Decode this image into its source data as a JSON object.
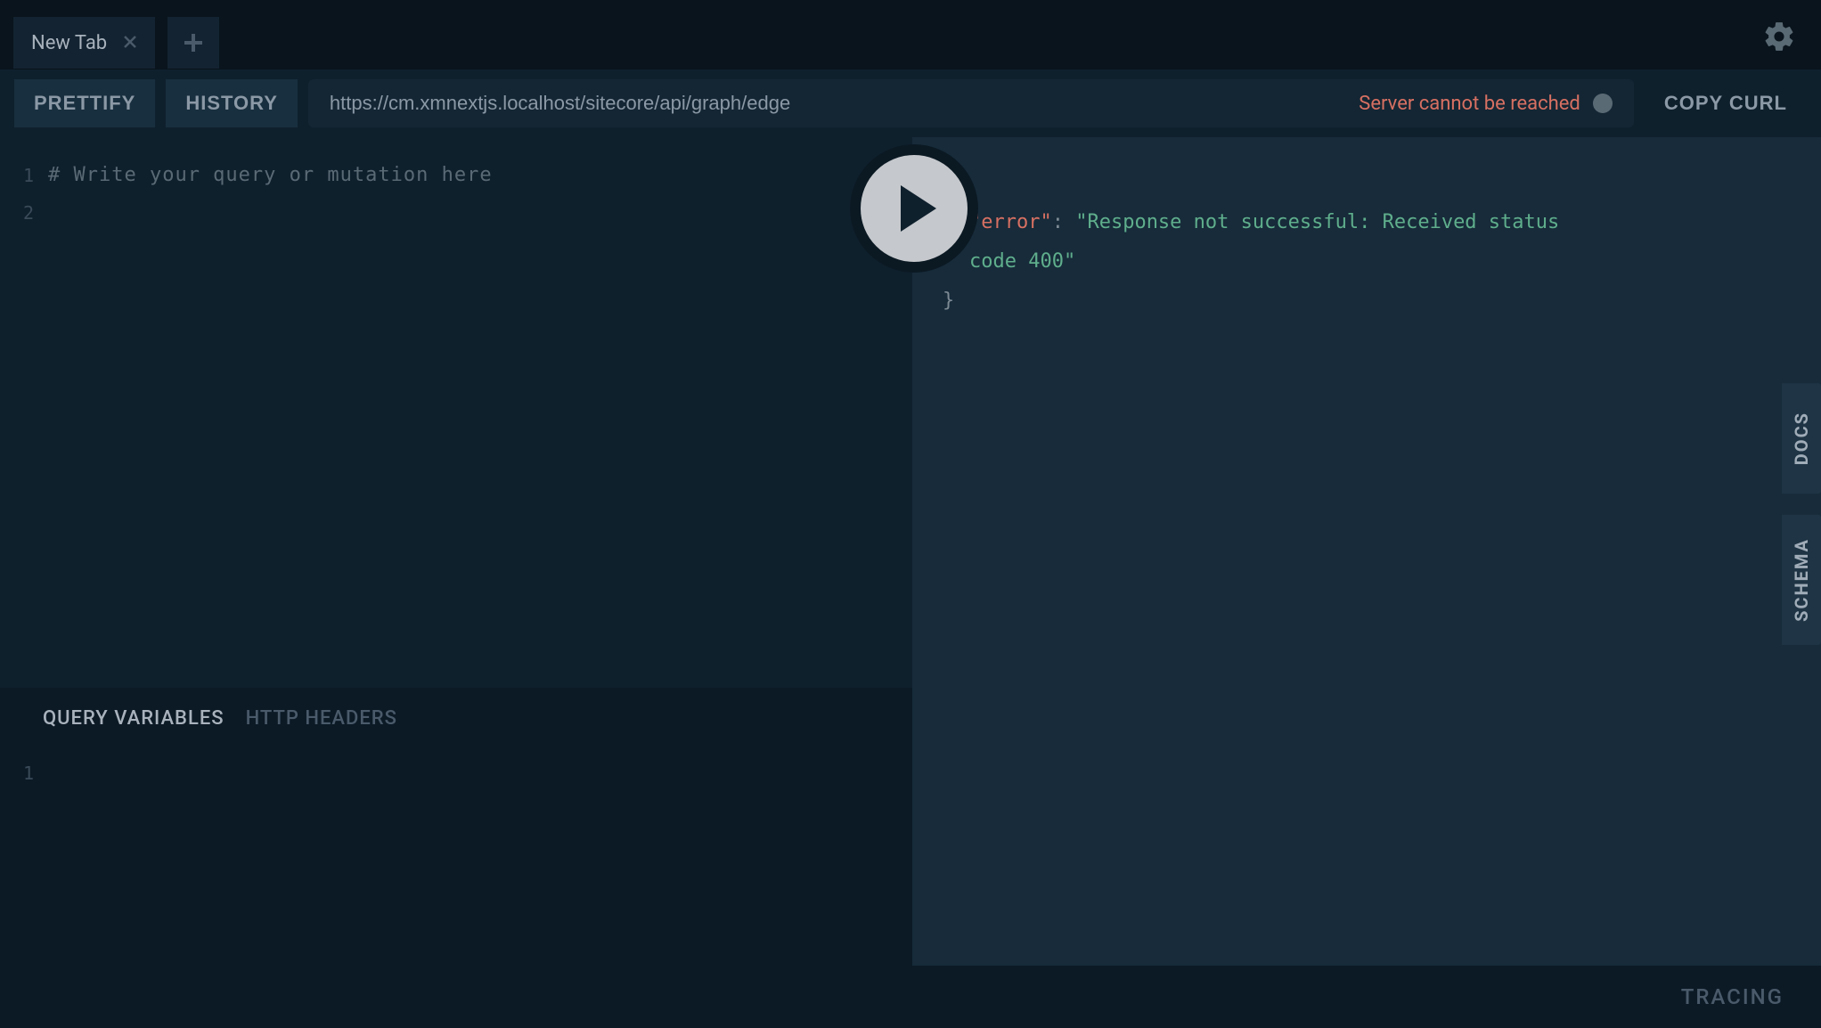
{
  "tabs": {
    "active_label": "New Tab"
  },
  "toolbar": {
    "prettify_label": "PRETTIFY",
    "history_label": "HISTORY",
    "url_value": "https://cm.xmnextjs.localhost/sitecore/api/graph/edge",
    "status_text": "Server cannot be reached",
    "copy_curl_label": "COPY CURL"
  },
  "editor": {
    "line_numbers": [
      "1",
      "2"
    ],
    "placeholder_comment": "# Write your query or mutation here"
  },
  "response": {
    "open_brace": "{",
    "key_quoted": "\"error\"",
    "colon": ": ",
    "value_quoted": "\"Response not successful: Received status code 400\"",
    "close_brace": "}"
  },
  "vars_panel": {
    "tab_variables": "QUERY VARIABLES",
    "tab_headers": "HTTP HEADERS",
    "line_numbers": [
      "1"
    ]
  },
  "side_tabs": {
    "docs": "DOCS",
    "schema": "SCHEMA"
  },
  "bottom": {
    "tracing_label": "TRACING"
  }
}
